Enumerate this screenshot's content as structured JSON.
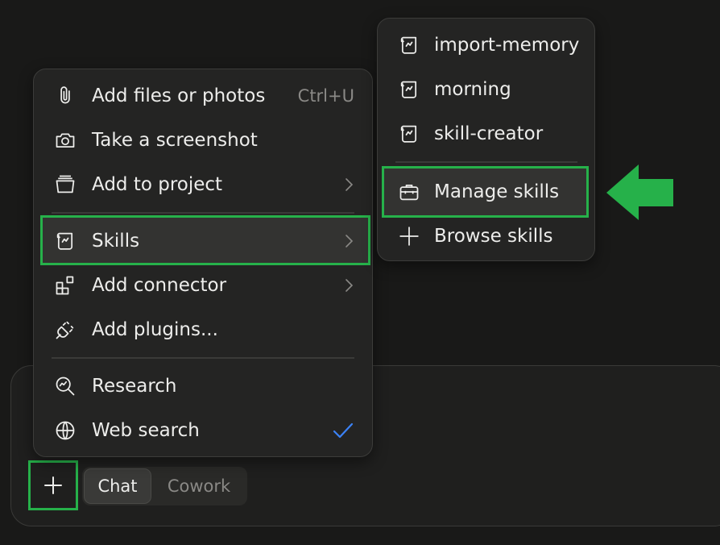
{
  "menu": {
    "items": [
      {
        "label": "Add files or photos",
        "shortcut": "Ctrl+U",
        "icon": "paperclip-icon"
      },
      {
        "label": "Take a screenshot",
        "icon": "camera-icon"
      },
      {
        "label": "Add to project",
        "icon": "project-box-icon",
        "submenu": true
      },
      {
        "label": "Skills",
        "icon": "skills-scroll-icon",
        "submenu": true,
        "highlighted": true
      },
      {
        "label": "Add connector",
        "icon": "connector-blocks-icon",
        "submenu": true
      },
      {
        "label": "Add plugins...",
        "icon": "plug-icon"
      },
      {
        "label": "Research",
        "icon": "research-magnifier-icon"
      },
      {
        "label": "Web search",
        "icon": "globe-icon",
        "checked": true
      }
    ]
  },
  "skills_submenu": {
    "items": [
      {
        "label": "import-memory",
        "icon": "skill-scroll-icon"
      },
      {
        "label": "morning",
        "icon": "skill-scroll-icon"
      },
      {
        "label": "skill-creator",
        "icon": "skill-scroll-icon"
      },
      {
        "label": "Manage skills",
        "icon": "toolbox-icon",
        "highlighted": true
      },
      {
        "label": "Browse skills",
        "icon": "plus-icon"
      }
    ]
  },
  "composer": {
    "modes": [
      "Chat",
      "Cowork"
    ],
    "active_mode": "Chat"
  },
  "colors": {
    "highlight": "#26b14a",
    "check": "#3b82f6"
  }
}
